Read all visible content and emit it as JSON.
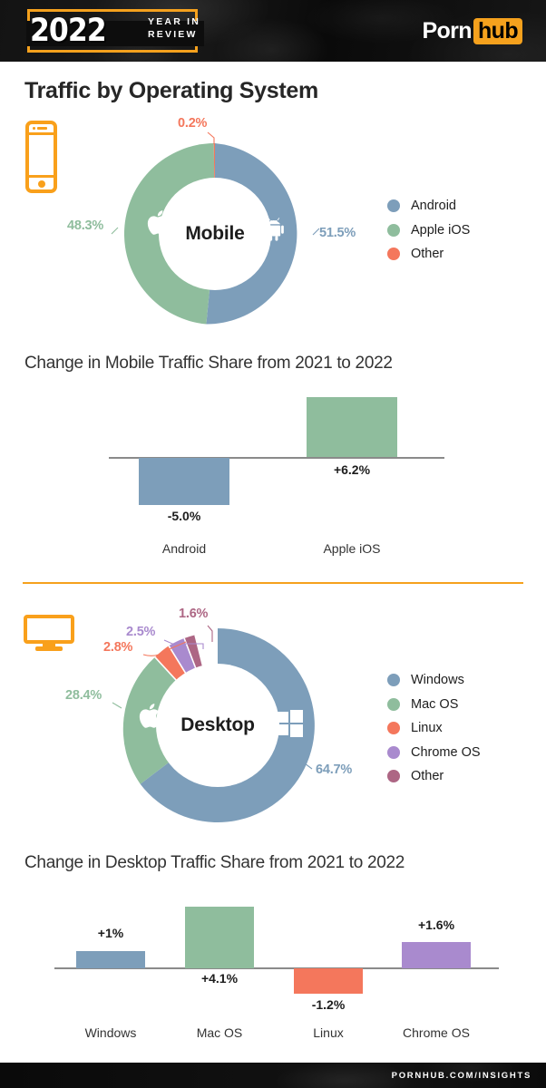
{
  "header": {
    "year": "2022",
    "subtitle_line1": "YEAR IN",
    "subtitle_line2": "REVIEW",
    "brand_part1": "Porn",
    "brand_part2": "hub"
  },
  "footer": {
    "url": "PORNHUB.COM/INSIGHTS"
  },
  "page_title": "Traffic by Operating System",
  "colors": {
    "blue": "#7d9eba",
    "green": "#8fbd9d",
    "orange": "#f4775c",
    "purple": "#a98ace",
    "mauve": "#ad6684",
    "brand_orange": "#f5a11d",
    "axis": "#8a8a8a"
  },
  "mobile": {
    "icon": "phone-icon",
    "center_label": "Mobile",
    "legend": [
      {
        "label": "Android",
        "color": "#7d9eba"
      },
      {
        "label": "Apple iOS",
        "color": "#8fbd9d"
      },
      {
        "label": "Other",
        "color": "#f4775c"
      }
    ],
    "callouts": [
      {
        "value": "0.2%",
        "color": "#f4775c"
      },
      {
        "value": "51.5%",
        "color": "#7d9eba"
      },
      {
        "value": "48.3%",
        "color": "#8fbd9d"
      }
    ]
  },
  "mobile_change": {
    "title": "Change in Mobile Traffic Share from 2021 to 2022"
  },
  "desktop": {
    "icon": "monitor-icon",
    "center_label": "Desktop",
    "legend": [
      {
        "label": "Windows",
        "color": "#7d9eba"
      },
      {
        "label": "Mac OS",
        "color": "#8fbd9d"
      },
      {
        "label": "Linux",
        "color": "#f4775c"
      },
      {
        "label": "Chrome OS",
        "color": "#a98ace"
      },
      {
        "label": "Other",
        "color": "#ad6684"
      }
    ],
    "callouts": [
      {
        "value": "1.6%",
        "color": "#ad6684"
      },
      {
        "value": "2.5%",
        "color": "#a98ace"
      },
      {
        "value": "2.8%",
        "color": "#f4775c"
      },
      {
        "value": "28.4%",
        "color": "#8fbd9d"
      },
      {
        "value": "64.7%",
        "color": "#7d9eba"
      }
    ]
  },
  "desktop_change": {
    "title": "Change in Desktop Traffic Share from 2021 to 2022"
  },
  "chart_data": [
    {
      "type": "pie",
      "title": "Mobile",
      "labels": [
        "Android",
        "Apple iOS",
        "Other"
      ],
      "values": [
        51.5,
        48.3,
        0.2
      ],
      "value_labels": [
        "51.5%",
        "48.3%",
        "0.2%"
      ],
      "colors": [
        "#7d9eba",
        "#8fbd9d",
        "#f4775c"
      ],
      "donut": true,
      "legend_position": "right"
    },
    {
      "type": "bar",
      "title": "Change in Mobile Traffic Share from 2021 to 2022",
      "categories": [
        "Android",
        "Apple iOS"
      ],
      "values": [
        -5.0,
        6.2
      ],
      "value_labels": [
        "-5.0%",
        "+6.2%"
      ],
      "colors": [
        "#7d9eba",
        "#8fbd9d"
      ],
      "xlabel": "",
      "ylabel": "",
      "ylim": [
        -6,
        7
      ],
      "grid": false
    },
    {
      "type": "pie",
      "title": "Desktop",
      "labels": [
        "Windows",
        "Mac OS",
        "Linux",
        "Chrome OS",
        "Other"
      ],
      "values": [
        64.7,
        28.4,
        2.8,
        2.5,
        1.6
      ],
      "value_labels": [
        "64.7%",
        "28.4%",
        "2.8%",
        "2.5%",
        "1.6%"
      ],
      "colors": [
        "#7d9eba",
        "#8fbd9d",
        "#f4775c",
        "#a98ace",
        "#ad6684"
      ],
      "donut": true,
      "legend_position": "right"
    },
    {
      "type": "bar",
      "title": "Change in Desktop Traffic Share from 2021 to 2022",
      "categories": [
        "Windows",
        "Mac OS",
        "Linux",
        "Chrome OS"
      ],
      "values": [
        1.0,
        4.1,
        -1.2,
        1.6
      ],
      "value_labels": [
        "+1%",
        "+4.1%",
        "-1.2%",
        "+1.6%"
      ],
      "colors": [
        "#7d9eba",
        "#8fbd9d",
        "#f4775c",
        "#a98ace"
      ],
      "xlabel": "",
      "ylabel": "",
      "ylim": [
        -2,
        5
      ],
      "grid": false
    }
  ]
}
